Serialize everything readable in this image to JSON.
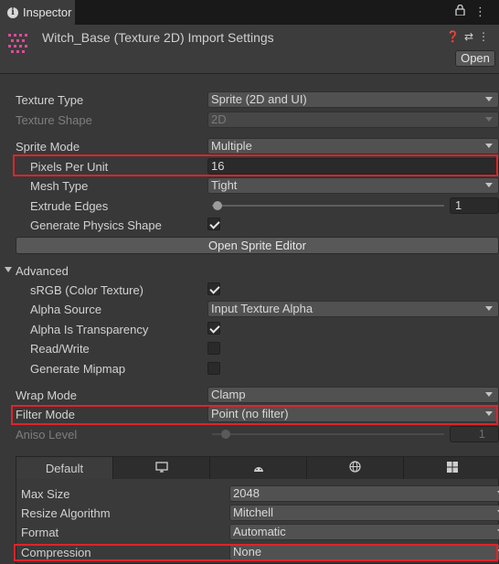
{
  "window": {
    "tab_label": "Inspector"
  },
  "header": {
    "title": "Witch_Base (Texture 2D) Import Settings",
    "open_label": "Open"
  },
  "texture_type": {
    "label": "Texture Type",
    "value": "Sprite (2D and UI)"
  },
  "texture_shape": {
    "label": "Texture Shape",
    "value": "2D"
  },
  "sprite_mode": {
    "label": "Sprite Mode",
    "value": "Multiple"
  },
  "pixels_per_unit": {
    "label": "Pixels Per Unit",
    "value": "16"
  },
  "mesh_type": {
    "label": "Mesh Type",
    "value": "Tight"
  },
  "extrude_edges": {
    "label": "Extrude Edges",
    "value": "1"
  },
  "generate_physics_shape": {
    "label": "Generate Physics Shape",
    "checked": true
  },
  "open_sprite_editor": {
    "label": "Open Sprite Editor"
  },
  "advanced": {
    "label": "Advanced",
    "srgb": {
      "label": "sRGB (Color Texture)",
      "checked": true
    },
    "alpha_source": {
      "label": "Alpha Source",
      "value": "Input Texture Alpha"
    },
    "alpha_is_transparency": {
      "label": "Alpha Is Transparency",
      "checked": true
    },
    "read_write": {
      "label": "Read/Write",
      "checked": false
    },
    "generate_mipmap": {
      "label": "Generate Mipmap",
      "checked": false
    }
  },
  "wrap_mode": {
    "label": "Wrap Mode",
    "value": "Clamp"
  },
  "filter_mode": {
    "label": "Filter Mode",
    "value": "Point (no filter)"
  },
  "aniso_level": {
    "label": "Aniso Level",
    "value": "1"
  },
  "platform": {
    "tabs": [
      {
        "label": "Default",
        "icon": ""
      },
      {
        "label": "",
        "icon": "monitor-icon"
      },
      {
        "label": "",
        "icon": "android-icon"
      },
      {
        "label": "",
        "icon": "globe-icon"
      },
      {
        "label": "",
        "icon": "windows-icon"
      }
    ],
    "max_size": {
      "label": "Max Size",
      "value": "2048"
    },
    "resize_algorithm": {
      "label": "Resize Algorithm",
      "value": "Mitchell"
    },
    "format": {
      "label": "Format",
      "value": "Automatic"
    },
    "compression": {
      "label": "Compression",
      "value": "None"
    }
  },
  "highlight_color": "#e0232a"
}
